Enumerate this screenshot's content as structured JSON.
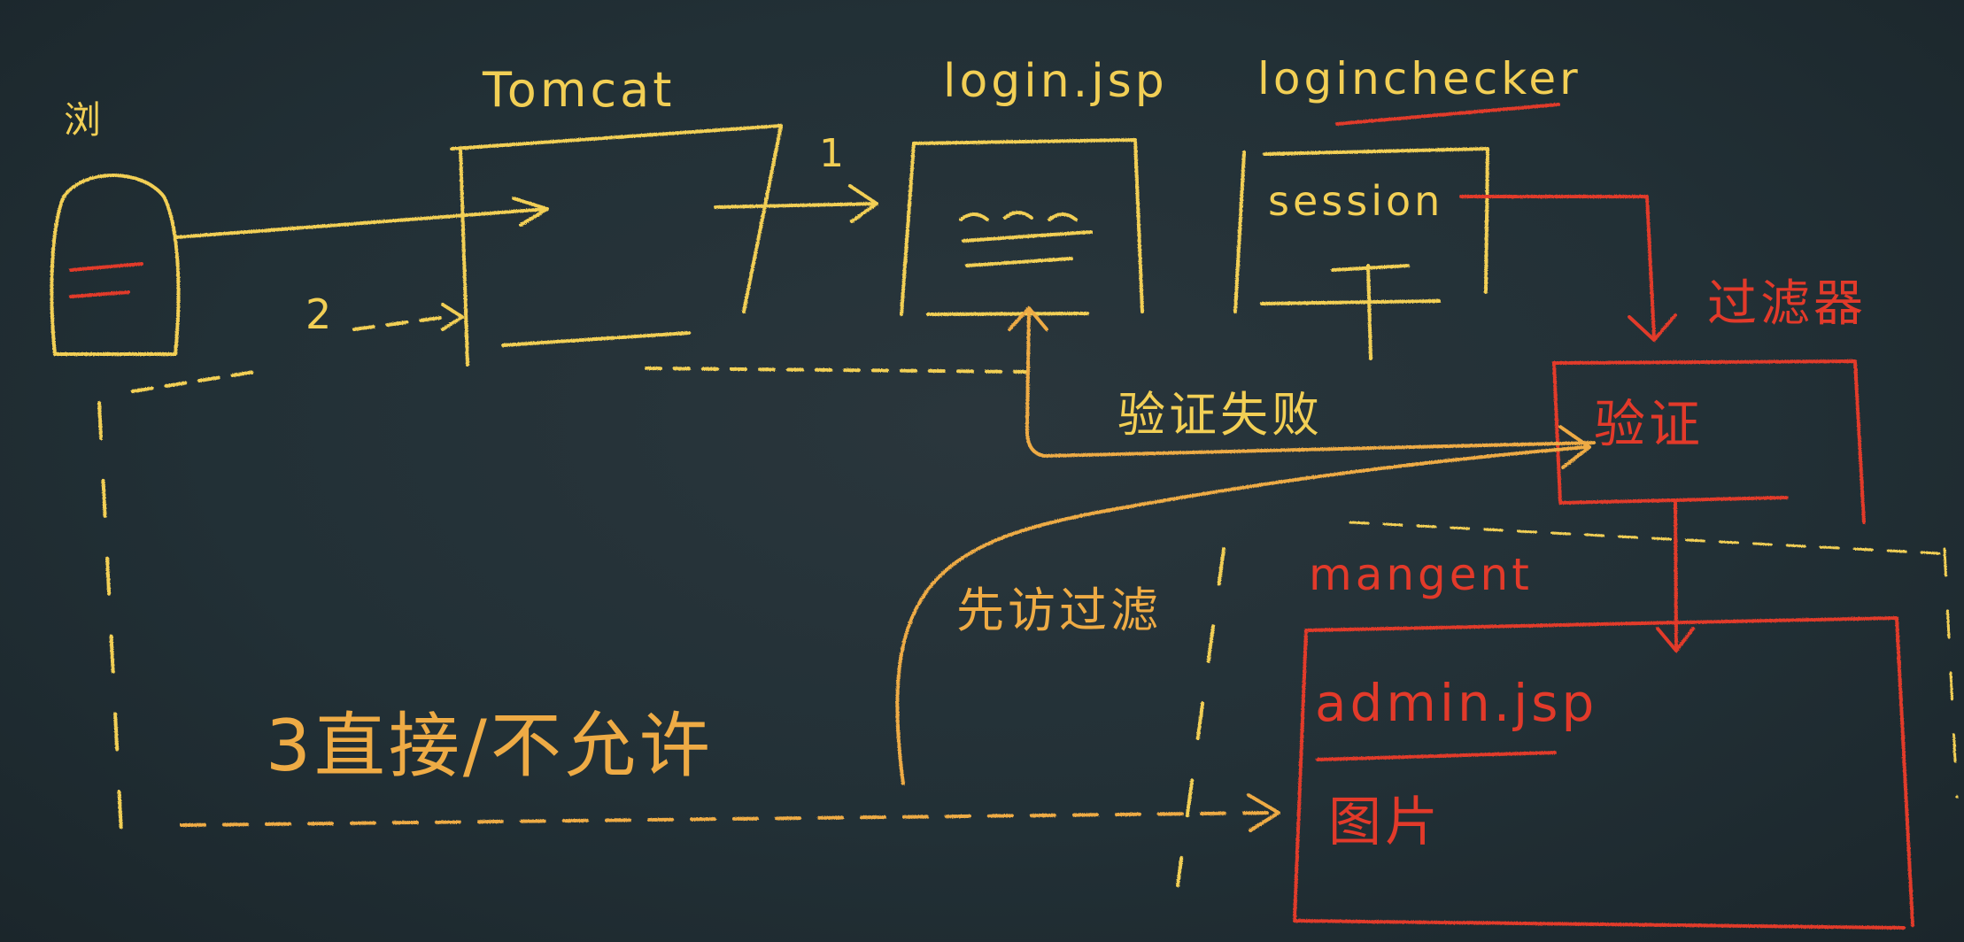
{
  "labels": {
    "browser": "浏",
    "tomcat": "Tomcat",
    "login_jsp": "login.jsp",
    "login_check": "loginchecker",
    "session": "session",
    "filter": "过滤器",
    "verify": "验证",
    "verify_fail": "验证失败",
    "through_filter": "先访过滤",
    "direct": "3直接/不允许",
    "step1": "1",
    "step2": "2",
    "management": "mangent",
    "admin_jsp": "admin.jsp",
    "image": "图片"
  },
  "colors": {
    "board": "#223036",
    "chalk_yellow": "#f2cf55",
    "chalk_orange": "#eeab45",
    "chalk_red": "#e23a2a"
  }
}
